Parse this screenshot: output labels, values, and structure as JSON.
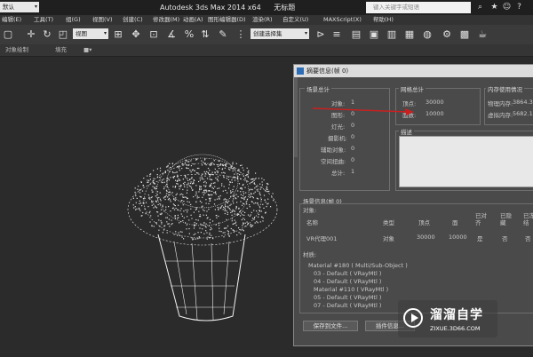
{
  "titlebar": {
    "workspace": "默认",
    "app_name": "Autodesk 3ds Max  2014 x64",
    "file_name": "无标题",
    "search_placeholder": "键入关键字或短语"
  },
  "menubar": [
    "编辑(E)",
    "工具(T)",
    "组(G)",
    "视图(V)",
    "创建(C)",
    "修改器(M)",
    "动画(A)",
    "图形编辑器(D)",
    "渲染(R)",
    "自定义(U)",
    "MAXScript(X)",
    "帮助(H)"
  ],
  "toolbar": {
    "view_dropdown": "视图",
    "selection_set_dropdown": "创建选择集"
  },
  "ribbon": {
    "item1": "对象绘制",
    "item2": "填充"
  },
  "dialog": {
    "title": "摘要信息(帧 0)",
    "scene_totals": {
      "label": "场景总计",
      "rows": [
        {
          "label": "对象:",
          "value": "1"
        },
        {
          "label": "图形:",
          "value": "0"
        },
        {
          "label": "灯光:",
          "value": "0"
        },
        {
          "label": "摄影机:",
          "value": "0"
        },
        {
          "label": "辅助对象:",
          "value": "0"
        },
        {
          "label": "空间扭曲:",
          "value": "0"
        },
        {
          "label": "总计:",
          "value": "1"
        }
      ]
    },
    "mesh_totals": {
      "label": "网格总计",
      "rows": [
        {
          "label": "顶点:",
          "value": "30000"
        },
        {
          "label": "面数:",
          "value": "10000"
        }
      ]
    },
    "memory": {
      "label": "内存使用情况",
      "rows": [
        {
          "label": "物理内存:",
          "value": "3864.3"
        },
        {
          "label": "虚拟内存:",
          "value": "5682.1"
        }
      ]
    },
    "description_label": "描述",
    "scene_info_label": "场景信息(帧 0)",
    "objects_label": "对象:",
    "table": {
      "headers": [
        "名称",
        "类型",
        "顶点",
        "面",
        "已对齐",
        "已隐藏",
        "已冻结"
      ],
      "row": [
        "VR代理001",
        "对象",
        "30000",
        "10000",
        "是",
        "否",
        "否"
      ]
    },
    "materials_label": "材质:",
    "materials": [
      "Material #180  ( Multi/Sub-Object )",
      "03 - Default  ( VRayMtl )",
      "04 - Default  ( VRayMtl )",
      "Material #110  ( VRayMtl )",
      "05 - Default  ( VRayMtl )",
      "07 - Default  ( VRayMtl )"
    ],
    "save_button": "保存到文件...",
    "plugin_button": "插件信息..."
  },
  "watermark": {
    "name": "溜溜自学",
    "url": "ZIXUE.3D66.COM"
  },
  "colors": {
    "annotation_arrow": "#cc1f1f",
    "viewport_bg": "#2b2b2b",
    "search_bar": "#f2f2f2"
  }
}
